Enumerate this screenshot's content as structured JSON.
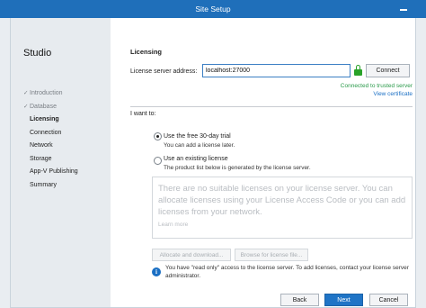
{
  "window": {
    "title": "Site Setup"
  },
  "sidebar": {
    "app_name": "Studio",
    "items": [
      {
        "label": "Introduction",
        "state": "done"
      },
      {
        "label": "Database",
        "state": "done"
      },
      {
        "label": "Licensing",
        "state": "active"
      },
      {
        "label": "Connection",
        "state": "pending"
      },
      {
        "label": "Network",
        "state": "pending"
      },
      {
        "label": "Storage",
        "state": "pending"
      },
      {
        "label": "App-V Publishing",
        "state": "pending"
      },
      {
        "label": "Summary",
        "state": "pending"
      }
    ]
  },
  "main": {
    "heading": "Licensing",
    "server_address_label": "License server address:",
    "server_address_value": "localhost:27000",
    "connect_label": "Connect",
    "status": "Connected to trusted server",
    "view_certificate": "View certificate",
    "i_want_to": "I want to:",
    "options": [
      {
        "label": "Use the free 30-day trial",
        "description": "You can add a license later.",
        "selected": true
      },
      {
        "label": "Use an existing license",
        "description": "The product list below is generated by the license server.",
        "selected": false
      }
    ],
    "empty_message": "There are no suitable licenses on your license server. You can allocate licenses using your License Access Code or you can add licenses from your network.",
    "learn_more": "Learn more",
    "allocate_label": "Allocate and download...",
    "browse_label": "Browse for license file...",
    "info_message": "You have \"read only\" access to the license server. To add licenses, contact your license server administrator."
  },
  "footer": {
    "back": "Back",
    "next": "Next",
    "cancel": "Cancel"
  },
  "colors": {
    "titlebar": "#1f6fba",
    "accent": "#1f74c6",
    "success": "#2a9a4a",
    "lock": "#29a329"
  },
  "icons": [
    "minimize-icon",
    "checkmark-icon",
    "lock-icon",
    "info-icon"
  ]
}
